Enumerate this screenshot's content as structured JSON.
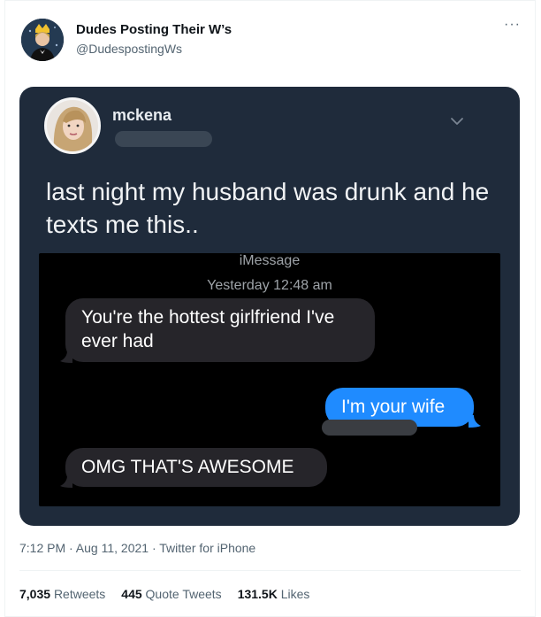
{
  "tweet": {
    "author_name": "Dudes Posting Their W’s",
    "author_handle": "@DudespostingWs",
    "more_glyph": "···",
    "timestamp": "7:12 PM · Aug 11, 2021",
    "separator": " · ",
    "client": "Twitter for iPhone",
    "stats": [
      {
        "count": "7,035",
        "label": "Retweets"
      },
      {
        "count": "445",
        "label": "Quote Tweets"
      },
      {
        "count": "131.5K",
        "label": "Likes"
      }
    ]
  },
  "media": {
    "poster_name": "mckena",
    "caption": "last night my husband was drunk and he texts me this..",
    "imessage": {
      "service_label": "iMessage",
      "time_label": "Yesterday 12:48 am",
      "messages": [
        {
          "text": "You're the hottest girlfriend I've ever had",
          "direction": "incoming"
        },
        {
          "text": "I'm your wife",
          "direction": "outgoing"
        },
        {
          "text": "OMG THAT'S AWESOME",
          "direction": "incoming"
        }
      ]
    }
  },
  "colors": {
    "accent_blue": "#1f8bff",
    "media_bg": "#1f2b3b",
    "text_secondary": "#536471"
  }
}
